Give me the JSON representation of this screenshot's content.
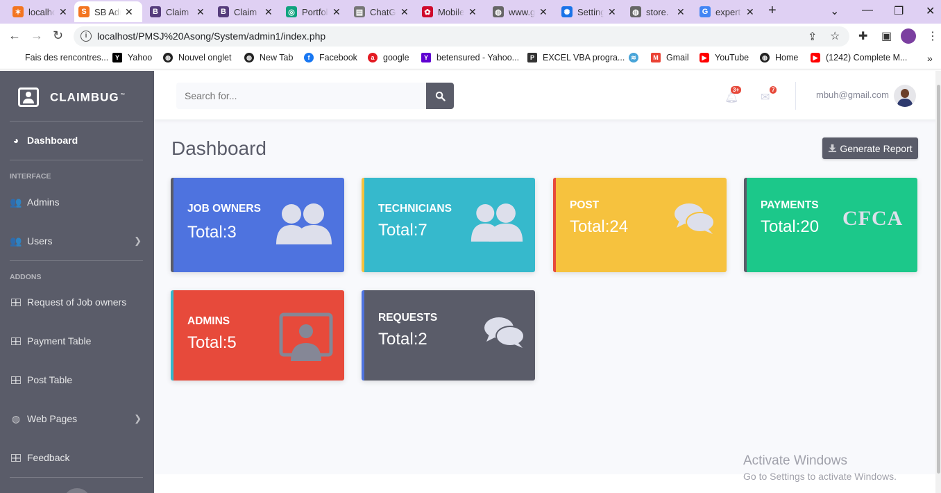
{
  "browser": {
    "tabs": [
      {
        "label": "localhost",
        "icon": "xampp-icon",
        "color": "#f37520",
        "glyph": "✶"
      },
      {
        "label": "SB Admin",
        "icon": "sb-admin-icon",
        "color": "#f37520",
        "glyph": "S"
      },
      {
        "label": "Claim",
        "icon": "bootstrap-icon",
        "color": "#563d7c",
        "glyph": "B"
      },
      {
        "label": "Claim",
        "icon": "bootstrap-icon",
        "color": "#563d7c",
        "glyph": "B"
      },
      {
        "label": "Portfolio",
        "icon": "chatgpt-icon",
        "color": "#10a37f",
        "glyph": "◎"
      },
      {
        "label": "ChatGPT",
        "icon": "book-icon",
        "color": "#777",
        "glyph": "▤"
      },
      {
        "label": "Mobile",
        "icon": "huawei-icon",
        "color": "#cf0a2c",
        "glyph": "✿"
      },
      {
        "label": "www.g",
        "icon": "globe-icon",
        "color": "#666",
        "glyph": "◍"
      },
      {
        "label": "Settings",
        "icon": "gear-icon",
        "color": "#1a73e8",
        "glyph": "✺"
      },
      {
        "label": "store.",
        "icon": "globe-icon",
        "color": "#666",
        "glyph": "◍"
      },
      {
        "label": "expert",
        "icon": "google-icon",
        "color": "#4285f4",
        "glyph": "G"
      }
    ],
    "url": "localhost/PMSJ%20Asong/System/admin1/index.php",
    "bookmarks": [
      {
        "label": "Fais des rencontres...",
        "icon": "",
        "color": ""
      },
      {
        "label": "Yahoo",
        "icon": "yahoo-icon",
        "color": "#000",
        "glyph": "Y"
      },
      {
        "label": "Nouvel onglet",
        "icon": "globe-icon",
        "color": "#222",
        "glyph": "◍"
      },
      {
        "label": "New Tab",
        "icon": "globe-icon",
        "color": "#222",
        "glyph": "◍"
      },
      {
        "label": "Facebook",
        "icon": "facebook-icon",
        "color": "#1877f2",
        "glyph": "f"
      },
      {
        "label": "google",
        "icon": "ask-icon",
        "color": "#e31b23",
        "glyph": "a"
      },
      {
        "label": "betensured - Yahoo...",
        "icon": "yahoo-icon",
        "color": "#5f01d1",
        "glyph": "Y"
      },
      {
        "label": "EXCEL VBA progra...",
        "icon": "pdf-icon",
        "color": "#333",
        "glyph": "P"
      },
      {
        "label": "",
        "icon": "cloud-icon",
        "color": "#48a4d8",
        "glyph": "≋"
      },
      {
        "label": "Gmail",
        "icon": "gmail-icon",
        "color": "#ea4335",
        "glyph": "M"
      },
      {
        "label": "YouTube",
        "icon": "youtube-icon",
        "color": "#ff0000",
        "glyph": "▶"
      },
      {
        "label": "Home",
        "icon": "globe-icon",
        "color": "#222",
        "glyph": "◍"
      },
      {
        "label": "(1242) Complete M...",
        "icon": "youtube-icon",
        "color": "#ff0000",
        "glyph": "▶"
      }
    ]
  },
  "sidebar": {
    "brand": "CLAIMBUG",
    "brand_sup": "~",
    "dashboard": "Dashboard",
    "interface_heading": "INTERFACE",
    "admins": "Admins",
    "users": "Users",
    "addons_heading": "ADDONS",
    "request_job_owners": "Request of Job owners",
    "payment_table": "Payment Table",
    "post_table": "Post Table",
    "web_pages": "Web Pages",
    "feedback": "Feedback"
  },
  "topbar": {
    "search_placeholder": "Search for...",
    "alerts_badge": "3+",
    "messages_badge": "7",
    "user_email": "mbuh@gmail.com"
  },
  "main": {
    "title": "Dashboard",
    "generate_report": "Generate Report",
    "cards": [
      {
        "title": "JOB OWNERS",
        "total": "Total:3",
        "bg": "#4e73df",
        "border": "#5a5c69",
        "icon": "users-icon"
      },
      {
        "title": "TECHNICIANS",
        "total": "Total:7",
        "bg": "#36b9cc",
        "border": "#f6c23e",
        "icon": "users-icon"
      },
      {
        "title": "POST",
        "total": "Total:24",
        "bg": "#f6c23e",
        "border": "#e74a3b",
        "icon": "comments-icon"
      },
      {
        "title": "PAYMENTS",
        "total": "Total:20",
        "bg": "#1cc88a",
        "border": "#5a5c69",
        "icon": "cfca-logo",
        "logo_text": "CFCA"
      },
      {
        "title": "ADMINS",
        "total": "Total:5",
        "bg": "#e74a3b",
        "border": "#36b9cc",
        "icon": "admin-icon"
      },
      {
        "title": "REQUESTS",
        "total": "Total:2",
        "bg": "#5a5c69",
        "border": "#4e73df",
        "icon": "comments-icon"
      }
    ]
  },
  "watermark": {
    "line1": "Activate Windows",
    "line2": "Go to Settings to activate Windows."
  }
}
